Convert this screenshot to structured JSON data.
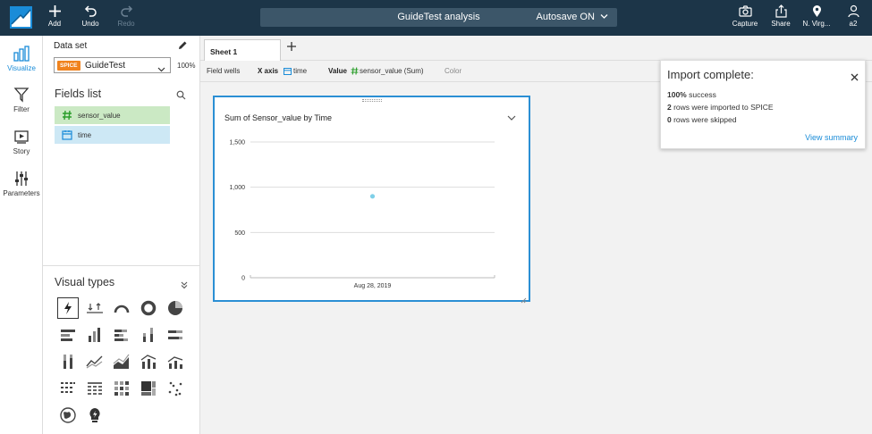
{
  "topbar": {
    "add_label": "Add",
    "undo_label": "Undo",
    "redo_label": "Redo",
    "analysis_name": "GuideTest analysis",
    "autosave": "Autosave ON",
    "capture_label": "Capture",
    "share_label": "Share",
    "region_label": "N. Virg...",
    "user_label": "a2",
    "colors": {
      "bar": "#1c3548",
      "title_box": "#3c5669"
    }
  },
  "rail": {
    "items": [
      {
        "label": "Visualize",
        "icon": "visualize-icon",
        "active": true
      },
      {
        "label": "Filter",
        "icon": "filter-icon"
      },
      {
        "label": "Story",
        "icon": "story-icon"
      },
      {
        "label": "Parameters",
        "icon": "parameters-icon"
      }
    ],
    "active_color": "#1a8cd8"
  },
  "dataset": {
    "label": "Data set",
    "badge": "SPICE",
    "name": "GuideTest",
    "percent": "100%",
    "badge_color": "#f0831e"
  },
  "fields": {
    "title": "Fields list",
    "items": [
      {
        "label": "sensor_value",
        "type": "measure",
        "color": "#cbe9c4"
      },
      {
        "label": "time",
        "type": "dimension",
        "color": "#cde8f5"
      }
    ]
  },
  "visual_types": {
    "title": "Visual types",
    "icons": [
      "autograph-icon",
      "kpi-icon",
      "gauge-icon",
      "donut-icon",
      "pie-icon",
      "horizontal-bar-icon",
      "vertical-bar-icon",
      "horizontal-stacked-bar-icon",
      "vertical-stacked-bar-icon",
      "horizontal-100-bar-icon",
      "vertical-100-bar-icon",
      "line-icon",
      "area-line-icon",
      "combo-bar-line-icon",
      "combo-stacked-line-icon",
      "pivot-table-icon",
      "table-icon",
      "heat-map-icon",
      "tree-map-icon",
      "scatter-icon",
      "geospatial-icon",
      "insight-icon"
    ],
    "selected": "autograph-icon"
  },
  "sheet": {
    "tab_label": "Sheet 1",
    "add_icon": "plus-icon"
  },
  "field_wells": {
    "title": "Field wells",
    "x_axis_label": "X axis",
    "x_axis_value": "time",
    "value_label": "Value",
    "value_value": "sensor_value (Sum)",
    "color_label": "Color"
  },
  "visual": {
    "title": "Sum of Sensor_value by Time",
    "border_color": "#2b8fd4"
  },
  "chart_data": {
    "type": "scatter",
    "title": "Sum of Sensor_value by Time",
    "xlabel": "",
    "ylabel": "",
    "categories": [
      "Aug 28, 2019"
    ],
    "series": [
      {
        "values": [
          900
        ]
      }
    ],
    "yticks": [
      "0",
      "500",
      "1,000",
      "1,500"
    ],
    "ylim": [
      0,
      1500
    ],
    "grid": true,
    "point_color": "#7fd0e8"
  },
  "toast": {
    "title": "Import complete:",
    "line1_bold": "100%",
    "line1_text": " success",
    "line2_bold": "2",
    "line2_text": " rows were imported to SPICE",
    "line3_bold": "0",
    "line3_text": " rows were skipped",
    "link": "View summary",
    "link_color": "#1a8cd8"
  }
}
